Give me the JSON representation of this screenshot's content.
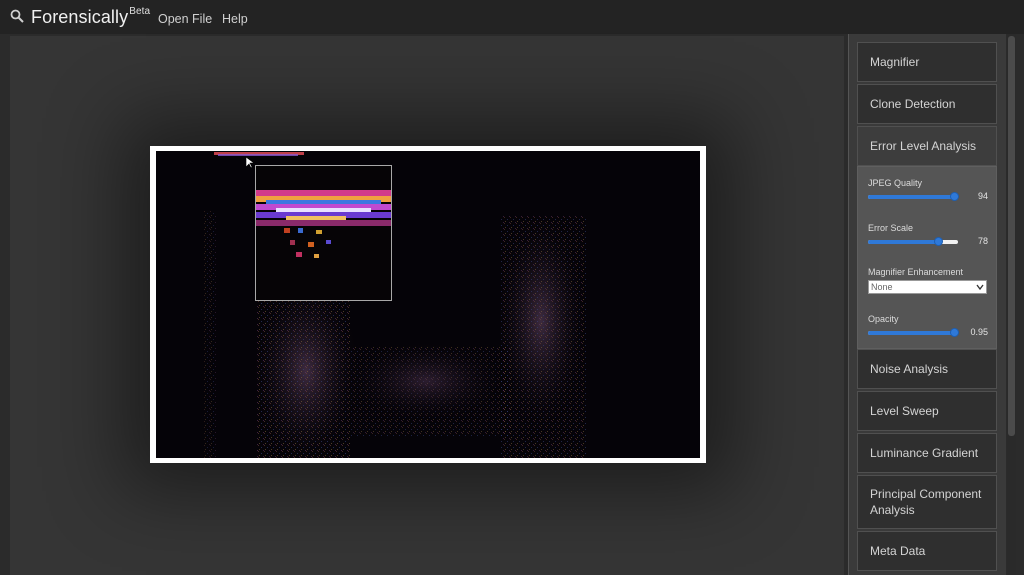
{
  "app": {
    "name": "Forensically",
    "badge": "Beta",
    "menu": {
      "open_file": "Open File",
      "help": "Help"
    }
  },
  "sidebar": {
    "tools": [
      {
        "label": "Magnifier"
      },
      {
        "label": "Clone Detection"
      },
      {
        "label": "Error Level Analysis"
      },
      {
        "label": "Noise Analysis"
      },
      {
        "label": "Level Sweep"
      },
      {
        "label": "Luminance Gradient"
      },
      {
        "label": "Principal Component Analysis"
      },
      {
        "label": "Meta Data"
      }
    ],
    "ela": {
      "jpeg_quality": {
        "label": "JPEG Quality",
        "value": "94",
        "fraction": 0.94
      },
      "error_scale": {
        "label": "Error Scale",
        "value": "78",
        "fraction": 0.78
      },
      "magnifier_enhancement": {
        "label": "Magnifier Enhancement",
        "selected": "None"
      },
      "opacity": {
        "label": "Opacity",
        "value": "0.95",
        "fraction": 0.95
      }
    }
  },
  "colors": {
    "accent": "#2f79d8",
    "topbar": "#232323",
    "workspace": "#353535",
    "panel": "#555555"
  },
  "icons": {
    "search": "search-icon",
    "cursor": "cursor-arrow-icon",
    "select": "chevron-down-icon"
  }
}
